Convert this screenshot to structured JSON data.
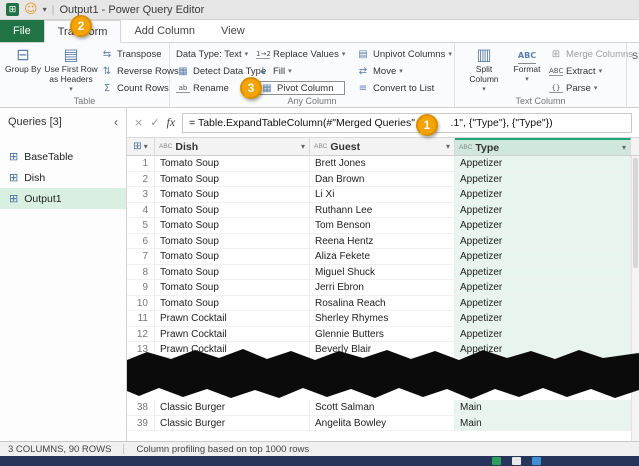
{
  "title_bar": {
    "title": "Output1 - Power Query Editor"
  },
  "tabs": [
    {
      "label": "File"
    },
    {
      "label": "Transform",
      "selected": true
    },
    {
      "label": "Add Column"
    },
    {
      "label": "View"
    }
  ],
  "ribbon": {
    "groups": {
      "table": {
        "label": "Table",
        "big": [
          {
            "label": "Group By"
          },
          {
            "label": "Use First Row as Headers"
          }
        ],
        "small": [
          {
            "label": "Transpose"
          },
          {
            "label": "Reverse Rows"
          },
          {
            "label": "Count Rows"
          }
        ]
      },
      "any_column": {
        "label": "Any Column",
        "col_a": [
          {
            "label": "Data Type: Text"
          },
          {
            "label": "Detect Data Type"
          },
          {
            "label": "Rename"
          }
        ],
        "col_b": [
          {
            "label": "Replace Values"
          },
          {
            "label": "Fill"
          },
          {
            "label": "Pivot Column",
            "highlighted": true
          }
        ],
        "col_c": [
          {
            "label": "Unpivot Columns"
          },
          {
            "label": "Move"
          },
          {
            "label": "Convert to List"
          }
        ]
      },
      "text_column": {
        "label": "Text Column",
        "big": [
          {
            "label": "Split Column"
          },
          {
            "label": "Format"
          }
        ],
        "small": [
          {
            "label": "Merge Columns",
            "disabled": true
          },
          {
            "label": "Extract"
          },
          {
            "label": "Parse"
          }
        ]
      },
      "partial": {
        "label": "S"
      }
    }
  },
  "queries_pane": {
    "header": "Queries [3]",
    "items": [
      {
        "label": "BaseTable"
      },
      {
        "label": "Dish"
      },
      {
        "label": "Output1",
        "selected": true
      }
    ]
  },
  "formula_bar": {
    "prefix": "= Table.ExpandTableColumn(#\"Merged Queries\", \"",
    "suffix": ".1\", {\"Type\"}, {\"Type\"})"
  },
  "grid": {
    "columns": [
      {
        "type_label": "ABC",
        "name": "Dish"
      },
      {
        "type_label": "ABC",
        "name": "Guest"
      },
      {
        "type_label": "ABC",
        "name": "Type",
        "selected": true
      }
    ],
    "rows": [
      {
        "n": "1",
        "dish": "Tomato Soup",
        "guest": "Brett Jones",
        "type": "Appetizer"
      },
      {
        "n": "2",
        "dish": "Tomato Soup",
        "guest": "Dan Brown",
        "type": "Appetizer"
      },
      {
        "n": "3",
        "dish": "Tomato Soup",
        "guest": "Li Xi",
        "type": "Appetizer"
      },
      {
        "n": "4",
        "dish": "Tomato Soup",
        "guest": "Ruthann Lee",
        "type": "Appetizer"
      },
      {
        "n": "5",
        "dish": "Tomato Soup",
        "guest": "Tom Benson",
        "type": "Appetizer"
      },
      {
        "n": "6",
        "dish": "Tomato Soup",
        "guest": "Reena Hentz",
        "type": "Appetizer"
      },
      {
        "n": "7",
        "dish": "Tomato Soup",
        "guest": "Aliza Fekete",
        "type": "Appetizer"
      },
      {
        "n": "8",
        "dish": "Tomato Soup",
        "guest": "Miguel Shuck",
        "type": "Appetizer"
      },
      {
        "n": "9",
        "dish": "Tomato Soup",
        "guest": "Jerri Ebron",
        "type": "Appetizer"
      },
      {
        "n": "10",
        "dish": "Tomato Soup",
        "guest": "Rosalina Reach",
        "type": "Appetizer"
      },
      {
        "n": "11",
        "dish": "Prawn Cocktail",
        "guest": "Sherley Rhymes",
        "type": "Appetizer"
      },
      {
        "n": "12",
        "dish": "Prawn Cocktail",
        "guest": "Glennie Butters",
        "type": "Appetizer"
      },
      {
        "n": "13",
        "dish": "Prawn Cocktail",
        "guest": "Beverly Blair",
        "type": "Appetizer"
      }
    ],
    "rows_after_tear": [
      {
        "n": "38",
        "dish": "Classic Burger",
        "guest": "Scott Salman",
        "type": "Main"
      },
      {
        "n": "39",
        "dish": "Classic Burger",
        "guest": "Angelita Bowley",
        "type": "Main"
      }
    ]
  },
  "status_bar": {
    "columns_rows": "3 COLUMNS, 90 ROWS",
    "profiling": "Column profiling based on top 1000 rows"
  },
  "callouts": {
    "one": "1",
    "two": "2",
    "three": "3"
  },
  "colors": {
    "file_tab_green": "#217346",
    "selected_column_green": "#e8f4ee",
    "callout_orange": "#f5a300",
    "selected_query_green": "#d9efe2"
  },
  "icons": {
    "app": "⊞",
    "smiley": "☺",
    "dropdown": "▾",
    "collapse": "‹",
    "cancel": "×",
    "check": "✓",
    "fx": "fx",
    "table": "⊞",
    "corner_table": "⊞",
    "filter": "▾",
    "group_by": "⊟",
    "first_row_headers": "▤",
    "transpose": "⇆",
    "reverse_rows": "⇅",
    "count_rows": "Σ",
    "detect": "▦",
    "rename": "ab",
    "replace": "1→2",
    "fill": "↓",
    "pivot": "▦",
    "unpivot": "▤",
    "move": "⇄",
    "to_list": "≡",
    "split": "▥",
    "format": "ABC",
    "merge": "⊞",
    "extract": "ABC",
    "parse": "{}"
  }
}
